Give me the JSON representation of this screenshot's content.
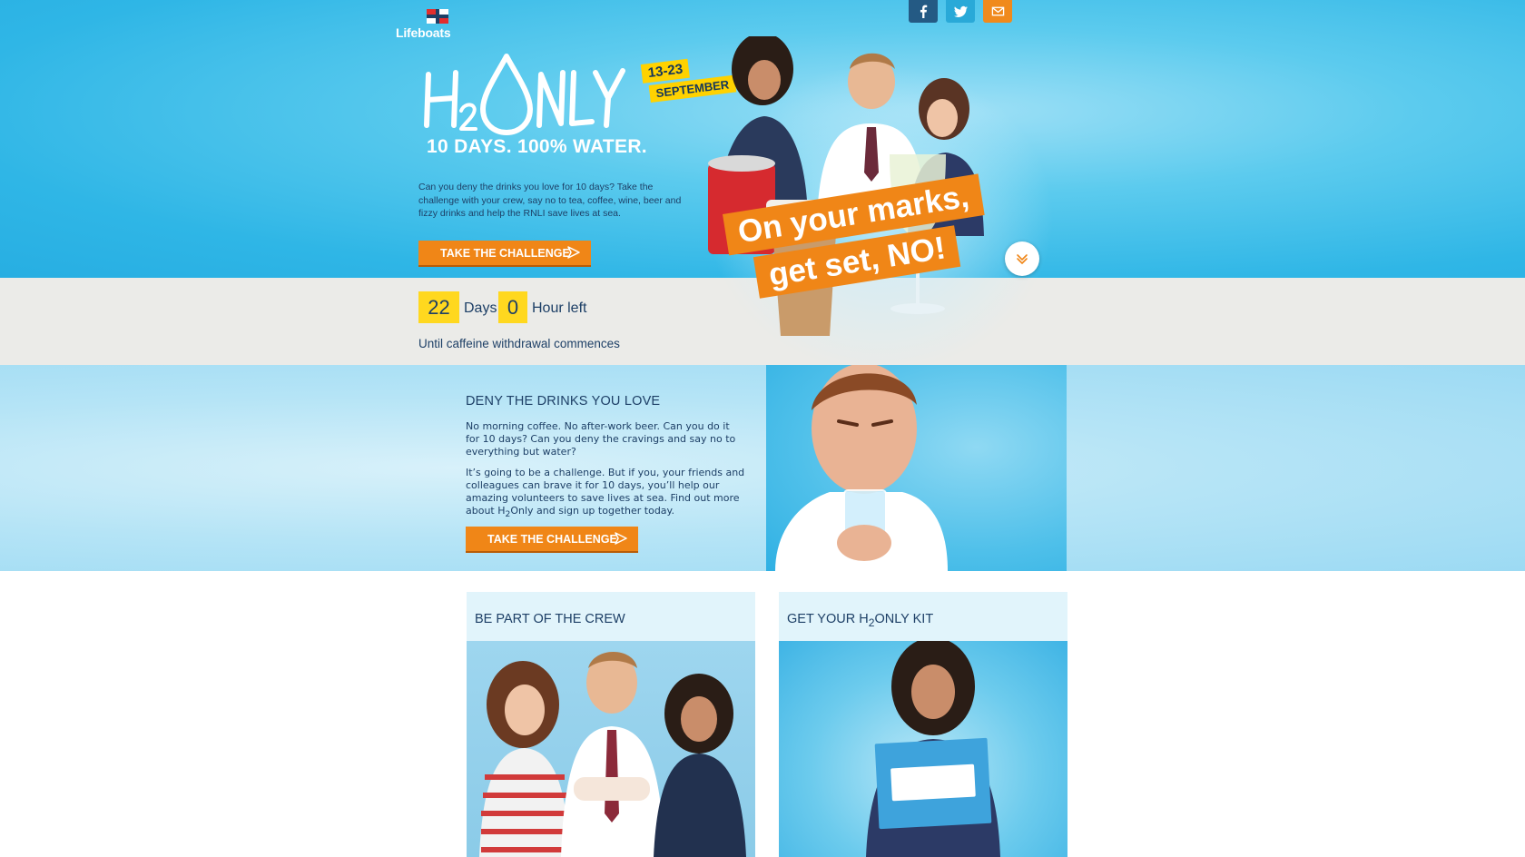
{
  "brand": {
    "logo_text": "Lifeboats"
  },
  "social": {
    "facebook": "facebook-icon",
    "twitter": "twitter-icon",
    "email": "email-icon"
  },
  "hero": {
    "date_line1": "13-23",
    "date_line2": "SEPTEMBER",
    "tagline": "10 DAYS. 100% WATER.",
    "copy": "Can you deny the drinks you love for 10 days? Take the challenge with your crew, say no to tea, coffee, wine, beer and fizzy drinks and help the RNLI save lives at sea.",
    "cta_label": "TAKE THE CHALLENGE",
    "slogan_line1": "On your marks,",
    "slogan_line2": "get set, NO!"
  },
  "countdown": {
    "days_value": "22",
    "days_label": "Days",
    "hours_value": "0",
    "hours_label": "Hour left",
    "subtitle": "Until caffeine withdrawal commences"
  },
  "deny": {
    "title": "DENY THE DRINKS YOU LOVE",
    "p1": "No morning coffee. No after-work beer. Can you do it for 10 days? Can you deny the cravings and say no to everything but water?",
    "p2_before": "It’s going to be a challenge. But if you, your friends and colleagues can brave it for 10 days, you’ll help our amazing volunteers to save lives at sea. Find out more about H",
    "p2_sub": "2",
    "p2_after": "Only and sign up together today.",
    "cta_label": "TAKE THE CHALLENGE"
  },
  "cards": {
    "crew_title": "BE PART OF THE CREW",
    "kit_title_before": "GET YOUR H",
    "kit_title_sub": "2",
    "kit_title_after": "ONLY KIT"
  },
  "colors": {
    "accent": "#f08617",
    "navy": "#1d3f66",
    "yellow": "#ffd81f",
    "sky": "#2fb6e6"
  }
}
